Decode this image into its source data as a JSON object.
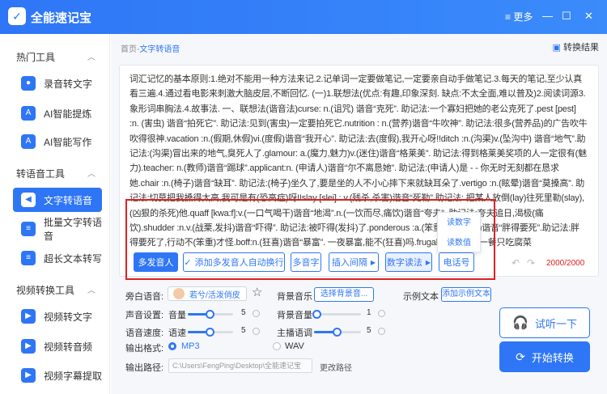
{
  "app": {
    "title": "全能速记宝",
    "more_label": "≡ 更多",
    "logo_icon": "logo-icon"
  },
  "sidebar": {
    "sections": [
      {
        "label": "热门工具",
        "items": [
          "录音转文字",
          "AI智能提炼",
          "AI智能写作"
        ]
      },
      {
        "label": "转语音工具",
        "items": [
          "文字转语音",
          "批量文字转语音",
          "超长文本转写"
        ]
      },
      {
        "label": "视频转换工具",
        "items": [
          "视频转文字",
          "视频转音频",
          "视频字幕提取"
        ]
      }
    ],
    "active": "文字转语音"
  },
  "breadcrumb": {
    "home": "首页",
    "separator": "-",
    "current": "文字转语音"
  },
  "header": {
    "result_label": "转换结果"
  },
  "editor": {
    "text": "词汇记忆的基本原则:1.绝对不能用一种方法来记.2.记单词一定要做笔记,一定要亲自动手做笔记.3.每天的笔记,至少认真看三遍.4.通过看电影来刺激大脑皮层,不断回忆. (一)1.联想法(优点:有趣,印象深刻. 缺点:不太全面,难以普及)2.阅读词源3.象形词串胸法.4.故事法. 一、联想法(谐音法)curse: n.(诅咒) 谐音“克死”. 助记法:一个寡妇把她的老公克死了.pest [pest] :n. (害虫) 谐音“拍死它”. 助记法:见到(害虫)一定要拍死它.nutrition : n.(营养)谐音“牛吹神”. 助记法:很多(营养品)的广告吹牛吹得很神.vacation :n.(假期,休假)vi.(度假)谐音“我开心”. 助记法:去(度假),我开心呀!!ditch :n.(沟渠)v.(坠沟中) 谐音“地气”.助记法:(沟渠)冒出来的地气,臭死人了.glamour: a.(魔力,魅力)v.(迷住)谐音“格莱美”. 助记法:得到格莱美奖项的人一定很有(魅力).teacher: n.(教师)谐音“踢球”.applicant:n. (申请人)谐音“尔不离恳她”. 助记法:(申请人)是 - - 你无时无刻都在恳求她.chair :n.(椅子)谐音“缺耳”. 助记法:(椅子)坐久了,要是坐的人不小心摔下来就缺耳朵了.vertigo :n.(眩晕)谐音“莫搡高”. 助记法:切莫把我搡得太高,我可是有(恐高症)呀!!slay [slei] : v.(残杀,杀害)谐音“死勒”.助记法: 把某人放倒(lay)往死里勒(slay),(凶狠的杀死)他.quaff [kwa:f]:v.(一口气喝干)谐音“地渴”.n.(一饮而尽,痛饮)谐音“夸夫”. 助记法:夸夫追日,渴极(痛饮).shudder :n.v.(战栗,发抖)谐音“吓得”. 助记法:被吓得(发抖)了.ponderous :a.(笨重的,笨拙的)谐音“胖得要死”.助记法:胖得要死了,行动不(笨重)才怪.boff:n.(狂喜)谐音“暴富”. 一夜暴富,能不(狂喜)吗.frugal:a.(节俭的)一餐只吃腐菜"
  },
  "popup": {
    "items": [
      "读数字",
      "读数值"
    ]
  },
  "toolbar": {
    "speaker": "多发音人",
    "auto_switch": "添加多发音人自动换行",
    "polyphone": "多音字",
    "insert_pause": "插入间隔",
    "number_reading": "数字读法",
    "phone_number": "电话号"
  },
  "counter": {
    "current": "2000",
    "max": "2000"
  },
  "settings": {
    "narrator_label": "旁白语音:",
    "narrator_voice": "若兮/活泼俏皮",
    "bgm_label": "背景音乐",
    "bgm_button": "选择背景音...",
    "example_label": "示例文本",
    "example_button": "添加示例文本",
    "sound_settings_label": "声音设置:",
    "volume_label": "音量",
    "volume_value": "5",
    "bg_volume_label": "背景音量",
    "bg_volume_value": "1",
    "speed_label": "语音速度:",
    "speed_sub_label": "语速",
    "speed_value": "5",
    "pitch_label": "主播语调",
    "pitch_value": "5",
    "format_label": "输出格式:",
    "format_mp3": "MP3",
    "format_wav": "WAV",
    "output_path_label": "输出路径:",
    "output_path": "C:\\Users\\FengPing\\Desktop\\全能速记宝",
    "change_path": "更改路径"
  },
  "actions": {
    "listen": "试听一下",
    "convert": "开始转换"
  },
  "colors": {
    "accent": "#2e76f6",
    "highlight": "#e02020"
  }
}
